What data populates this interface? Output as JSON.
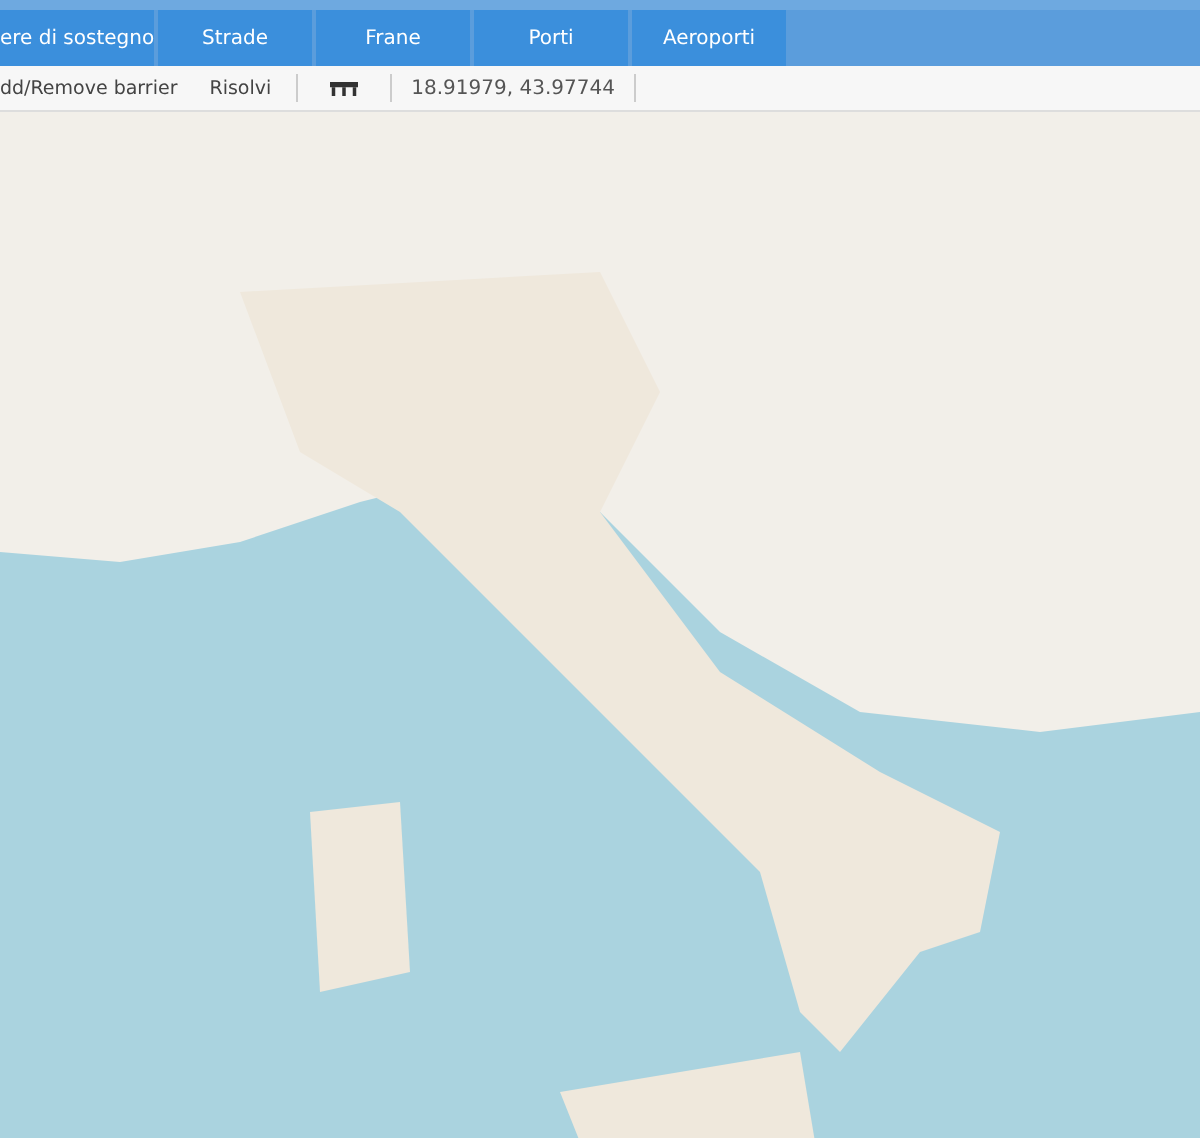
{
  "tabs": [
    {
      "label": "ere di sostegno"
    },
    {
      "label": "Strade"
    },
    {
      "label": "Frane"
    },
    {
      "label": "Porti"
    },
    {
      "label": "Aeroporti"
    }
  ],
  "toolbar": {
    "barrier_action": "dd/Remove barrier",
    "solve_action": "Risolvi",
    "coordinates": "18.91979, 43.97744"
  }
}
